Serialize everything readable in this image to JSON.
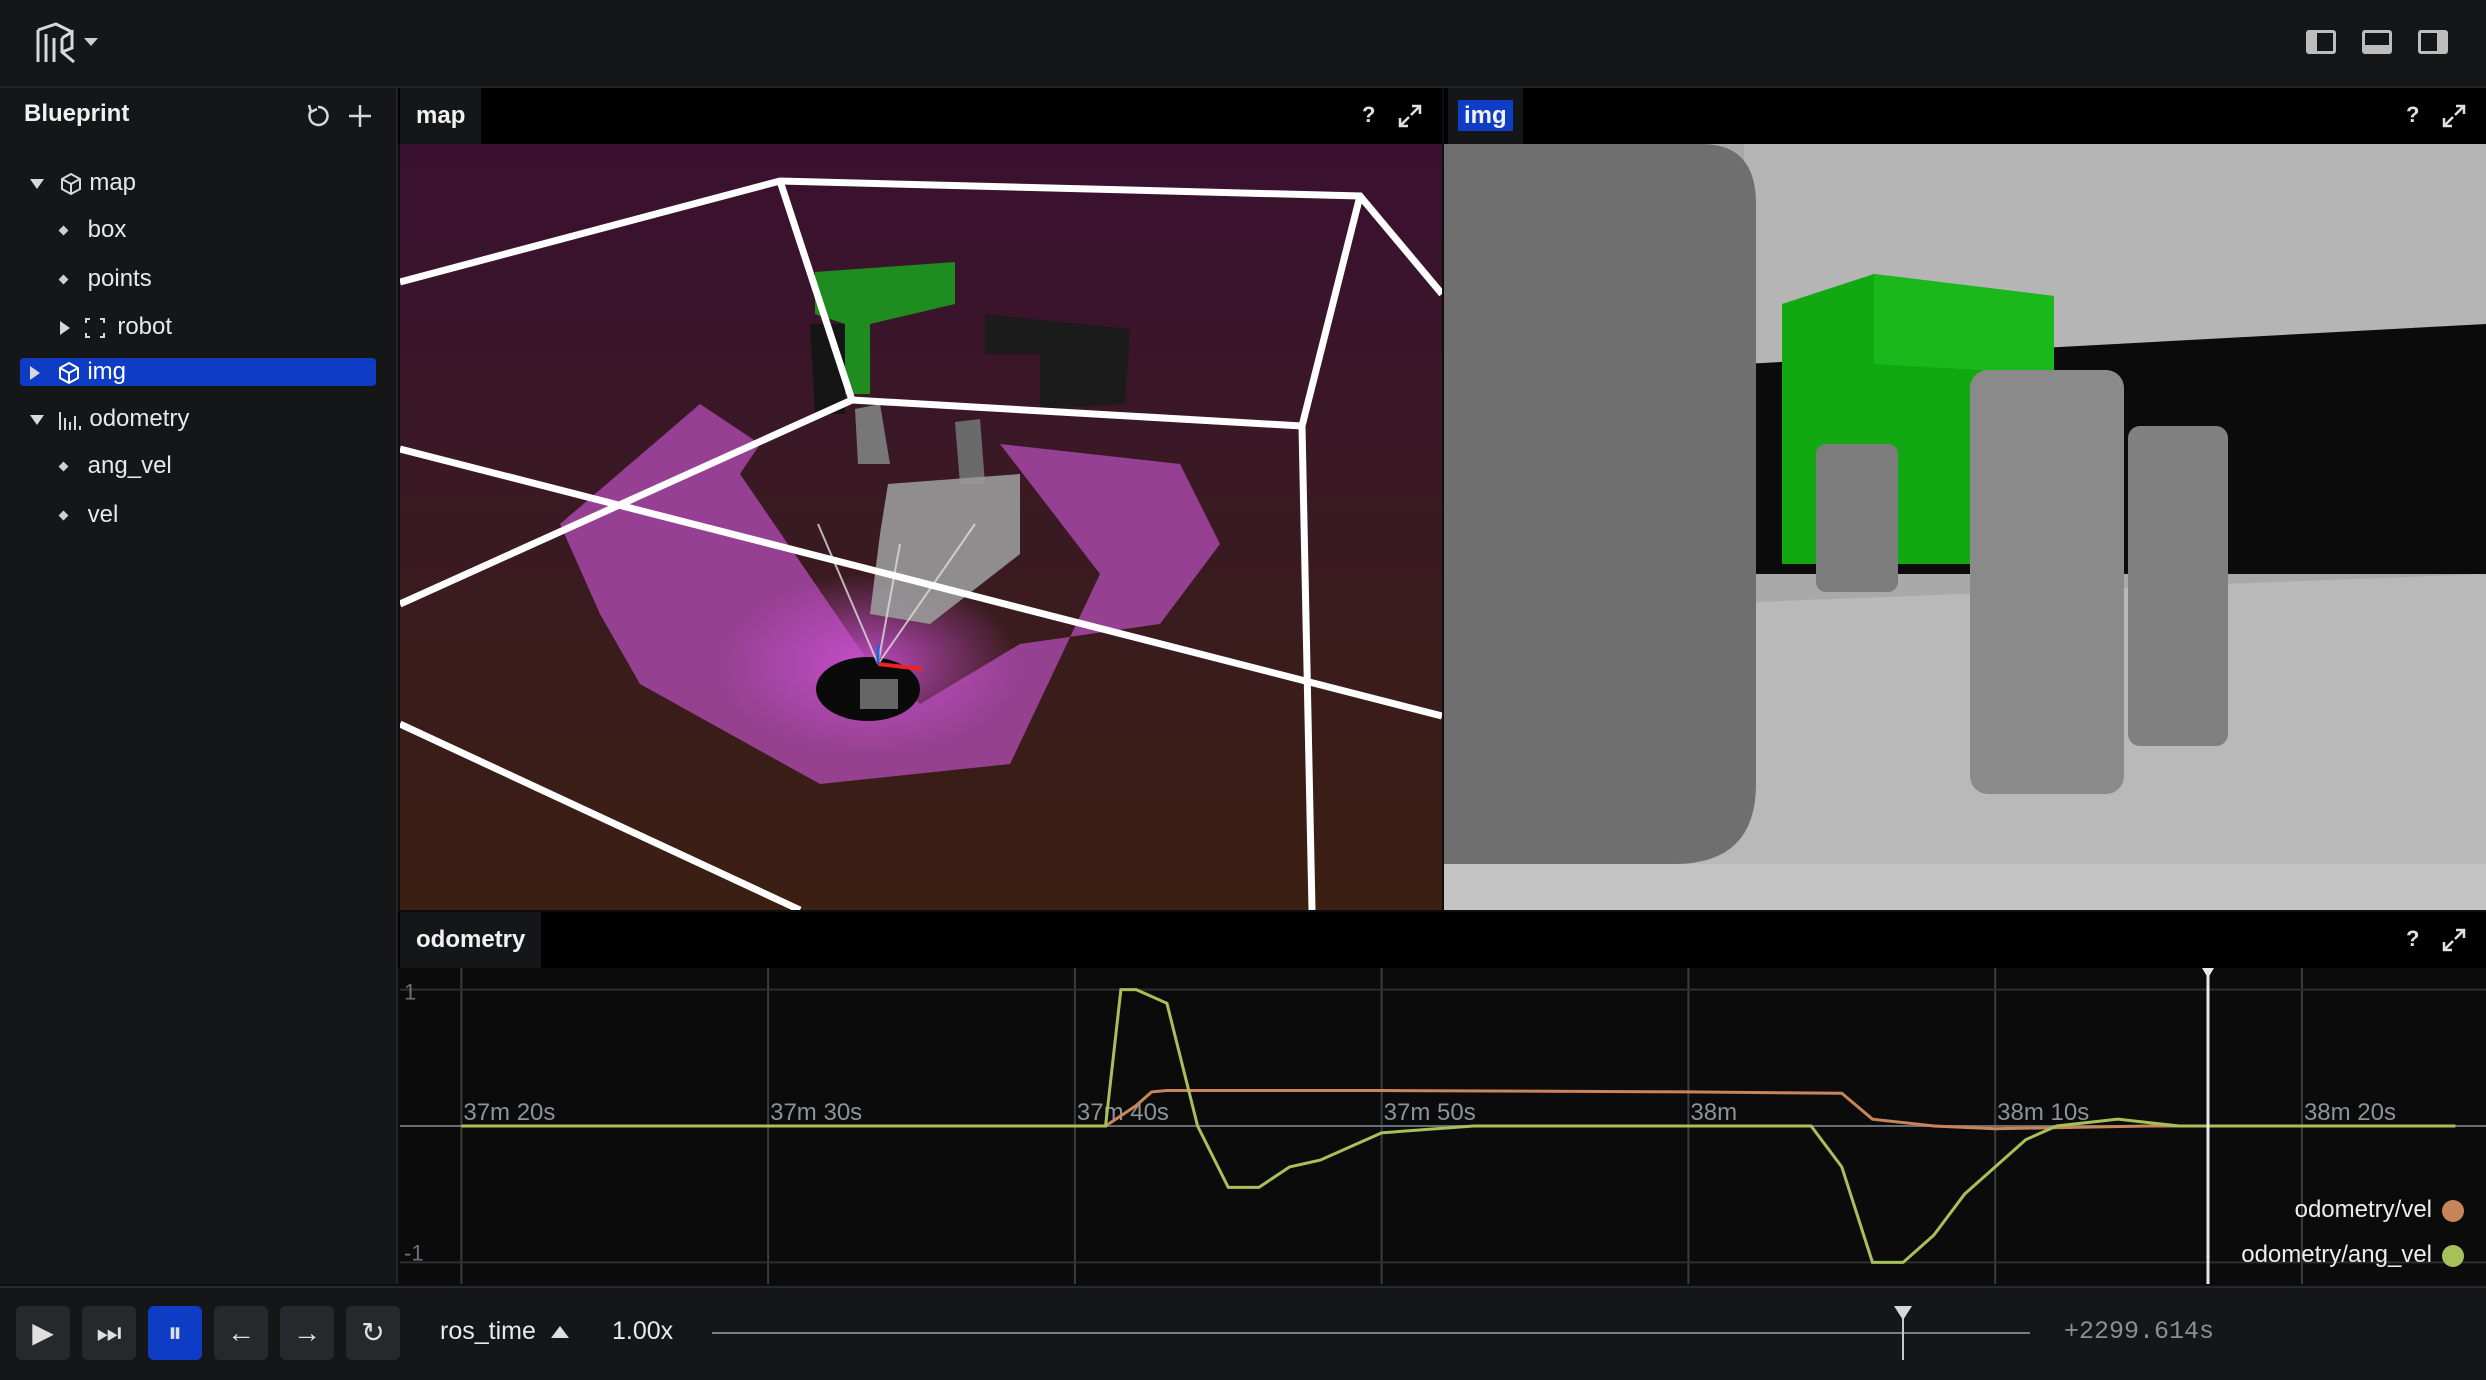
{
  "app": {
    "logo_icon": "rerun-logo-icon"
  },
  "colors": {
    "accent": "#0f3cc4",
    "vel_series": "#c9855a",
    "ang_vel_series": "#a8c05a",
    "map_bg_top": "#3a1030",
    "map_bg_bottom": "#3b1f12"
  },
  "blueprint": {
    "title": "Blueprint",
    "items": [
      {
        "label": "map",
        "icon": "cube-icon",
        "level": 0,
        "expanded": true
      },
      {
        "label": "box",
        "icon": "entity-dot-icon",
        "level": 1
      },
      {
        "label": "points",
        "icon": "entity-dot-icon",
        "level": 1
      },
      {
        "label": "robot",
        "icon": "group-icon",
        "level": 1,
        "expanded": false
      },
      {
        "label": "img",
        "icon": "cube-icon",
        "level": 0,
        "expanded": false,
        "selected": true
      },
      {
        "label": "odometry",
        "icon": "timeseries-icon",
        "level": 0,
        "expanded": true
      },
      {
        "label": "ang_vel",
        "icon": "entity-dot-icon",
        "level": 1
      },
      {
        "label": "vel",
        "icon": "entity-dot-icon",
        "level": 1
      }
    ]
  },
  "panels": {
    "map": {
      "tab": "map",
      "help": "?"
    },
    "img": {
      "tab": "img",
      "help": "?"
    },
    "odometry": {
      "tab": "odometry",
      "help": "?"
    }
  },
  "chart_data": {
    "type": "line",
    "x_tick_labels": [
      "37m 20s",
      "37m 30s",
      "37m 40s",
      "37m 50s",
      "38m",
      "38m 10s",
      "38m 20s"
    ],
    "y_tick_labels": [
      "1",
      "-1"
    ],
    "xlim": [
      1038,
      1106
    ],
    "ylim": [
      -1.1,
      1.1
    ],
    "series": [
      {
        "name": "odometry/vel",
        "x": [
          1040,
          1061,
          1062,
          1062.5,
          1063,
          1070,
          1080,
          1085,
          1086,
          1088,
          1090,
          1095,
          1100,
          1105
        ],
        "y": [
          0.0,
          0.0,
          0.15,
          0.25,
          0.26,
          0.26,
          0.25,
          0.24,
          0.05,
          0.0,
          -0.02,
          0.0,
          0.0,
          0.0
        ]
      },
      {
        "name": "odometry/ang_vel",
        "x": [
          1040,
          1061,
          1061.5,
          1062,
          1063,
          1064,
          1065,
          1066,
          1067,
          1068,
          1070,
          1073,
          1076,
          1080,
          1084,
          1085,
          1086,
          1087,
          1088,
          1089,
          1090,
          1091,
          1092,
          1094,
          1096,
          1100,
          1105
        ],
        "y": [
          0.0,
          0.0,
          1.0,
          1.0,
          0.9,
          0.0,
          -0.45,
          -0.45,
          -0.3,
          -0.25,
          -0.05,
          0.0,
          0.0,
          0.0,
          0.0,
          -0.3,
          -1.0,
          -1.0,
          -0.8,
          -0.5,
          -0.3,
          -0.1,
          0.0,
          0.05,
          0.0,
          0.0,
          0.0
        ]
      }
    ]
  },
  "timeline": {
    "play": "▶",
    "step_end": "⏭",
    "pause": "⏸",
    "back": "←",
    "forward": "→",
    "loop": "↻",
    "timeline_name": "ros_time",
    "speed": "1.00x",
    "time_readout": "+2299.614s",
    "playhead_position": 0.863
  }
}
